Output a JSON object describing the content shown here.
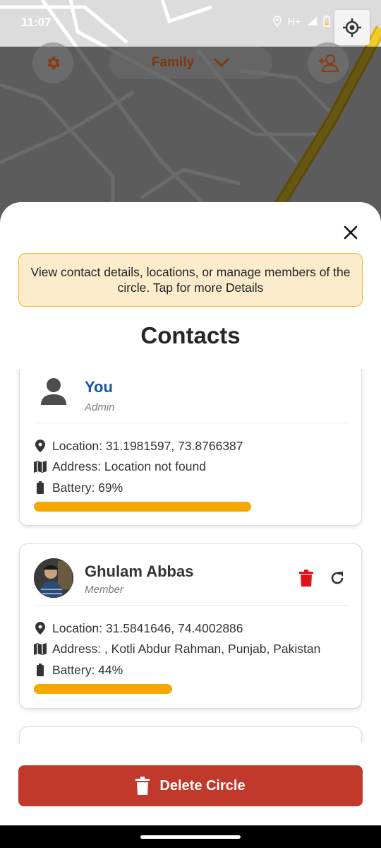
{
  "status_bar": {
    "time": "11:07",
    "signal_label": "H+"
  },
  "header": {
    "circle_name": "Family"
  },
  "sheet": {
    "info_banner": "View contact details, locations, or manage members of the circle. Tap for more Details",
    "title": "Contacts"
  },
  "contacts": [
    {
      "name": "You",
      "role": "Admin",
      "location": "Location: 31.1981597, 73.8766387",
      "address": "Address: Location not found",
      "battery": "Battery: 69%",
      "battery_level": 0.69,
      "name_color": "#1757a6"
    },
    {
      "name": "Ghulam Abbas",
      "role": "Member",
      "location": "Location: 31.5841646, 74.4002886",
      "address": "Address: , Kotli Abdur Rahman, Punjab, Pakistan",
      "battery": "Battery: 44%",
      "battery_level": 0.44,
      "name_color": "#333333"
    }
  ],
  "footer": {
    "delete_label": "Delete Circle"
  },
  "colors": {
    "accent": "#f5a800",
    "danger": "#c0392b",
    "delete_icon": "#e3121a",
    "banner_bg": "#fdeccc"
  },
  "icons": [
    "settings-icon",
    "chevron-down-icon",
    "add-person-icon",
    "my-location-icon",
    "close-icon",
    "person-icon",
    "location-pin-icon",
    "map-icon",
    "battery-icon",
    "trash-icon",
    "refresh-icon"
  ]
}
